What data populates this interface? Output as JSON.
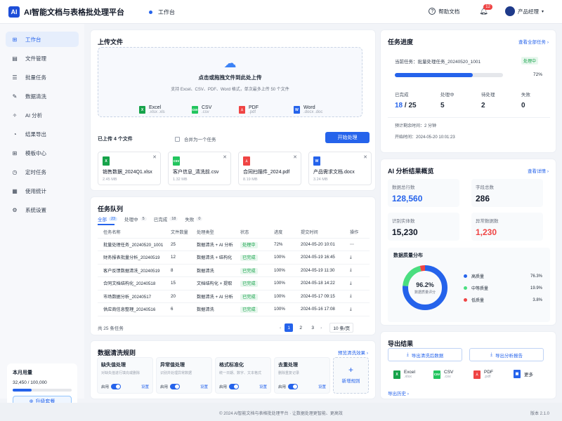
{
  "header": {
    "logo": "AI",
    "title": "AI智能文档与表格批处理平台",
    "crumb": "工作台",
    "help": "帮助文档",
    "bell_count": "12",
    "user": "产品经理"
  },
  "sidebar": {
    "items": [
      {
        "icon": "⊞",
        "label": "工作台"
      },
      {
        "icon": "▤",
        "label": "文件管理"
      },
      {
        "icon": "☰",
        "label": "批量任务"
      },
      {
        "icon": "✎",
        "label": "数据清洗"
      },
      {
        "icon": "✧",
        "label": "AI 分析"
      },
      {
        "icon": "◔",
        "label": "结果导出"
      },
      {
        "icon": "⊞",
        "label": "模板中心"
      },
      {
        "icon": "◷",
        "label": "定时任务"
      },
      {
        "icon": "▦",
        "label": "使用统计"
      },
      {
        "icon": "⚙",
        "label": "系统设置"
      }
    ],
    "usage": {
      "title": "本月用量",
      "value": "32,450 / 100,000",
      "pct": 0.3245,
      "upgrade": "升级套餐"
    }
  },
  "upload": {
    "title": "上传文件",
    "drop_main": "点击或拖拽文件到此处上传",
    "drop_sub": "支持 Excel、CSV、PDF、Word 格式，单次最多上传 50 个文件",
    "formats": [
      {
        "name": "Excel",
        "ext": ".xlsx .xls",
        "color": "#16a34a",
        "tag": "X"
      },
      {
        "name": "CSV",
        "ext": ".csv",
        "color": "#22c55e",
        "tag": "csv"
      },
      {
        "name": "PDF",
        "ext": ".pdf",
        "color": "#ef4444",
        "tag": "⅄"
      },
      {
        "name": "Word",
        "ext": ".docx .doc",
        "color": "#2563eb",
        "tag": "W"
      }
    ],
    "uploaded": "已上传 4 个文件",
    "merge": "合并为一个任务",
    "start": "开始处理",
    "files": [
      {
        "name": "销售数据_2024Q1.xlsx",
        "size": "2.45 MB",
        "color": "#16a34a",
        "tag": "X"
      },
      {
        "name": "客户信息_清洗前.csv",
        "size": "1.32 MB",
        "color": "#22c55e",
        "tag": "csv"
      },
      {
        "name": "合同扫描件_2024.pdf",
        "size": "8.19 MB",
        "color": "#ef4444",
        "tag": "⅄"
      },
      {
        "name": "产品需求文档.docx",
        "size": "3.24 MB",
        "color": "#2563eb",
        "tag": "W"
      }
    ]
  },
  "queue": {
    "title": "任务队列",
    "tabs": [
      {
        "label": "全部",
        "count": "23"
      },
      {
        "label": "处理中",
        "count": "5"
      },
      {
        "label": "已完成",
        "count": "18"
      },
      {
        "label": "失败",
        "count": "0"
      }
    ],
    "columns": [
      "任务名称",
      "文件数量",
      "处理类型",
      "状态",
      "进度",
      "提交时间",
      "操作"
    ],
    "rows": [
      [
        "批量处理任务_20240520_1001",
        "25",
        "数据清洗 + AI 分析",
        "处理中",
        "72%",
        "2024-05-20 10:01",
        "⋯"
      ],
      [
        "财务报表批量分析_20240519",
        "12",
        "数据清洗 + 结构化",
        "已完成",
        "100%",
        "2024-05-19 16:45",
        "⤓"
      ],
      [
        "客户反馈数据清洗_20240519",
        "8",
        "数据清洗",
        "已完成",
        "100%",
        "2024-05-19 11:30",
        "⤓"
      ],
      [
        "合同文档结构化_20240518",
        "15",
        "文档结构化 + 提取",
        "已完成",
        "100%",
        "2024-05-18 14:22",
        "⤓"
      ],
      [
        "市场数据分析_20240517",
        "20",
        "数据清洗 + AI 分析",
        "已完成",
        "100%",
        "2024-05-17 09:15",
        "⤓"
      ],
      [
        "供应商信息整理_20240516",
        "6",
        "数据清洗",
        "已完成",
        "100%",
        "2024-05-16 17:08",
        "⤓"
      ]
    ],
    "total": "共 25 条任务",
    "pages": [
      "1",
      "2",
      "3"
    ],
    "per_page": "10 条/页"
  },
  "rules": {
    "title": "数据清洗规则",
    "link": "预览清洗效果 ›",
    "items": [
      {
        "title": "缺失值处理",
        "desc": "对缺失值进行填充或删除",
        "enable": "启用",
        "set": "设置"
      },
      {
        "title": "异常值处理",
        "desc": "识别并处理异常数据",
        "enable": "启用",
        "set": "设置"
      },
      {
        "title": "格式标准化",
        "desc": "统一日期、数字、文本格式",
        "enable": "启用",
        "set": "设置"
      },
      {
        "title": "去重处理",
        "desc": "删除重复记录",
        "enable": "启用",
        "set": "设置"
      }
    ],
    "new": "新增规则"
  },
  "progress": {
    "title": "任务进度",
    "link": "查看全部任务 ›",
    "current_label": "当前任务：",
    "current": "批量处理任务_20240520_1001",
    "status": "处理中",
    "pct": "72%",
    "pct_value": 0.72,
    "stats": [
      {
        "label": "已完成",
        "value": "18",
        "of": " / 25"
      },
      {
        "label": "处理中",
        "value": "5"
      },
      {
        "label": "待处理",
        "value": "2"
      },
      {
        "label": "失败",
        "value": "0"
      }
    ],
    "eta": "预计剩余时间：2 分钟",
    "start": "开始时间：2024-05-20 10:01:23"
  },
  "ai": {
    "title": "AI 分析结果概览",
    "link": "查看详情 ›",
    "stats": [
      {
        "label": "数据总行数",
        "value": "128,560",
        "color": "#2563eb"
      },
      {
        "label": "字段总数",
        "value": "286",
        "color": "#111827"
      },
      {
        "label": "识别实体数",
        "value": "15,230",
        "color": "#111827"
      },
      {
        "label": "异常数据数",
        "value": "1,230",
        "color": "#ef4444"
      }
    ],
    "dist_title": "数据质量分布",
    "score": "96.2%",
    "score_label": "数据质量评分",
    "legend": [
      {
        "label": "高质量",
        "value": "76.3%",
        "color": "#2563eb"
      },
      {
        "label": "中等质量",
        "value": "19.9%",
        "color": "#4ade80"
      },
      {
        "label": "低质量",
        "value": "3.8%",
        "color": "#ef4444"
      }
    ]
  },
  "export": {
    "title": "导出结果",
    "btn1": "导出清洗后数据",
    "btn2": "导出分析报告",
    "formats": [
      {
        "name": "Excel",
        "ext": ".xlsx",
        "color": "#16a34a",
        "tag": "X"
      },
      {
        "name": "CSV",
        "ext": ".csv",
        "color": "#22c55e",
        "tag": "csv"
      },
      {
        "name": "PDF",
        "ext": ".pdf",
        "color": "#ef4444",
        "tag": "⅄"
      },
      {
        "name": "更多",
        "ext": "",
        "color": "#2563eb",
        "tag": "▦"
      }
    ],
    "history": "导出历史 ›"
  },
  "footer": {
    "text": "© 2024 AI智能文档与表格批处理平台 · 让数据处理更智能、更高效",
    "version": "版本 2.1.0"
  }
}
